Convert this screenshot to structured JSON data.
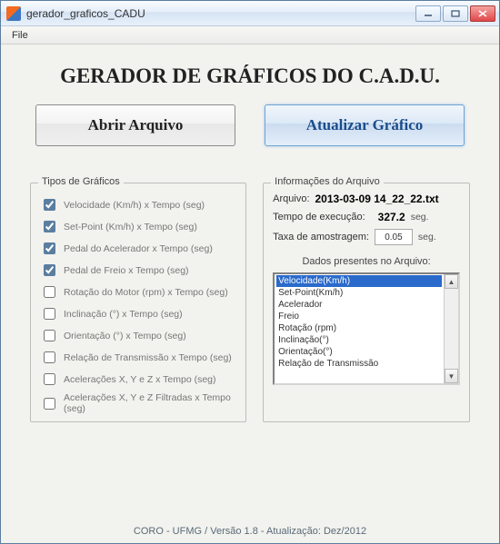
{
  "window": {
    "title": "gerador_graficos_CADU"
  },
  "menubar": {
    "file": "File"
  },
  "header": {
    "title": "GERADOR DE GRÁFICOS DO C.A.D.U."
  },
  "buttons": {
    "open": "Abrir Arquivo",
    "update": "Atualizar Gráfico"
  },
  "tipos": {
    "legend": "Tipos de Gráficos",
    "items": [
      {
        "label": "Velocidade (Km/h) x Tempo (seg)",
        "checked": true
      },
      {
        "label": "Set-Point (Km/h) x Tempo (seg)",
        "checked": true
      },
      {
        "label": "Pedal do Acelerador  x Tempo (seg)",
        "checked": true
      },
      {
        "label": "Pedal de Freio  x Tempo (seg)",
        "checked": true
      },
      {
        "label": "Rotação do Motor (rpm)  x Tempo (seg)",
        "checked": false
      },
      {
        "label": "Inclinação (°)  x Tempo (seg)",
        "checked": false
      },
      {
        "label": "Orientação (°)  x Tempo (seg)",
        "checked": false
      },
      {
        "label": "Relação de Transmissão  x Tempo (seg)",
        "checked": false
      },
      {
        "label": "Acelerações X, Y e Z  x Tempo (seg)",
        "checked": false
      },
      {
        "label": "Acelerações X, Y e Z Filtradas  x Tempo (seg)",
        "checked": false
      }
    ]
  },
  "info": {
    "legend": "Informações do Arquivo",
    "file_label": "Arquivo:",
    "file_value": "2013-03-09 14_22_22.txt",
    "exec_label": "Tempo de execução:",
    "exec_value": "327.2",
    "exec_unit": "seg.",
    "rate_label": "Taxa de amostragem:",
    "rate_value": "0.05",
    "rate_unit": "seg.",
    "list_heading": "Dados presentes no Arquivo:",
    "list": [
      "Velocidade(Km/h)",
      "Set-Point(Km/h)",
      "Acelerador",
      "Freio",
      "Rotação (rpm)",
      "Inclinação(°)",
      "Orientação(°)",
      "Relação de Transmissão"
    ],
    "selected_index": 0
  },
  "footer": "CORO - UFMG / Versão 1.8 - Atualização: Dez/2012"
}
